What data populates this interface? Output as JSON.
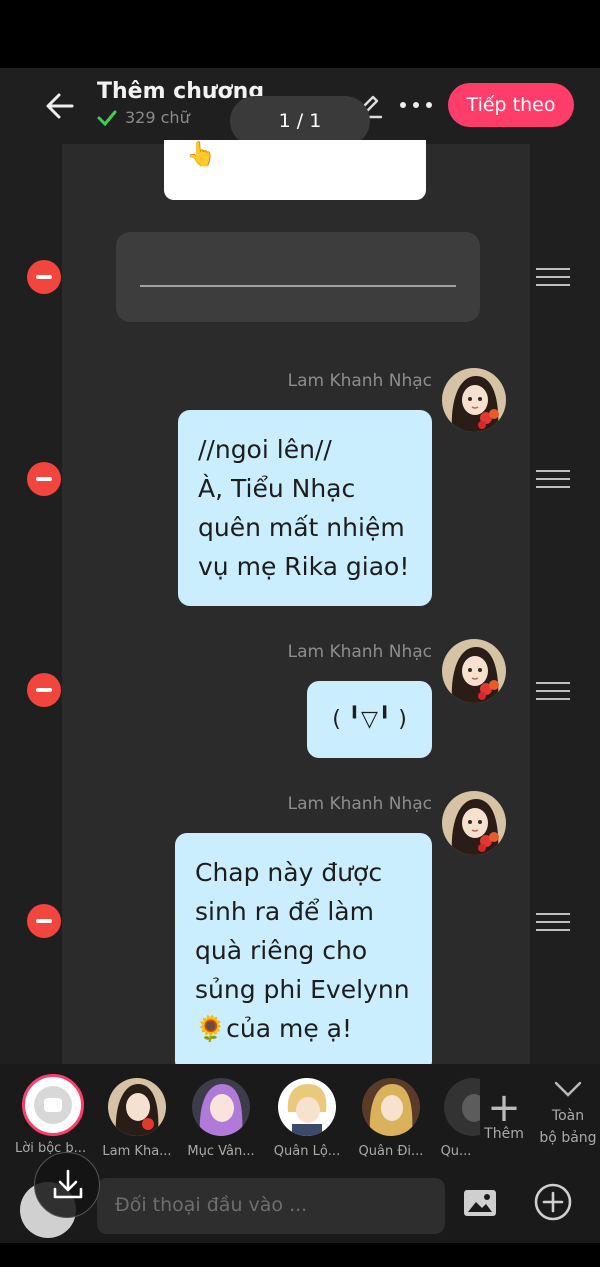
{
  "header": {
    "title": "Thêm chương",
    "word_count": "329 chữ",
    "page_indicator": "1 / 1",
    "next_label": "Tiếp theo"
  },
  "messages": [
    {
      "speaker": "Lam Khanh Nhạc",
      "lines": [
        "//ngoi lên//",
        "À, Tiểu Nhạc",
        "quên mất nhiệm",
        "vụ mẹ Rika giao!"
      ]
    },
    {
      "speaker": "Lam Khanh Nhạc",
      "lines": [
        "( ╹▽╹ )"
      ]
    },
    {
      "speaker": "Lam Khanh Nhạc",
      "lines": [
        "Chap này được",
        "sinh ra để làm",
        "quà riêng cho",
        "sủng phi Evelynn",
        "🌻của mẹ ạ!"
      ]
    }
  ],
  "characters": {
    "narration_label": "Lời bộc b...",
    "items": [
      {
        "name": "Lam Kha...",
        "color": "#5a4036"
      },
      {
        "name": "Mục Vân...",
        "color": "#b07ad8"
      },
      {
        "name": "Quân Lộ...",
        "color": "#e9c97a"
      },
      {
        "name": "Quân Đi...",
        "color": "#d9b25b"
      },
      {
        "name": "Qu...",
        "color": "#444444"
      }
    ],
    "add_label": "Thêm",
    "all_label_line1": "Toàn",
    "all_label_line2": "bộ bảng"
  },
  "input": {
    "placeholder": "Đối thoại đầu vào ..."
  },
  "colors": {
    "accent": "#ff3d6a",
    "bubble": "#cbeeff",
    "remove": "#f2453d"
  }
}
